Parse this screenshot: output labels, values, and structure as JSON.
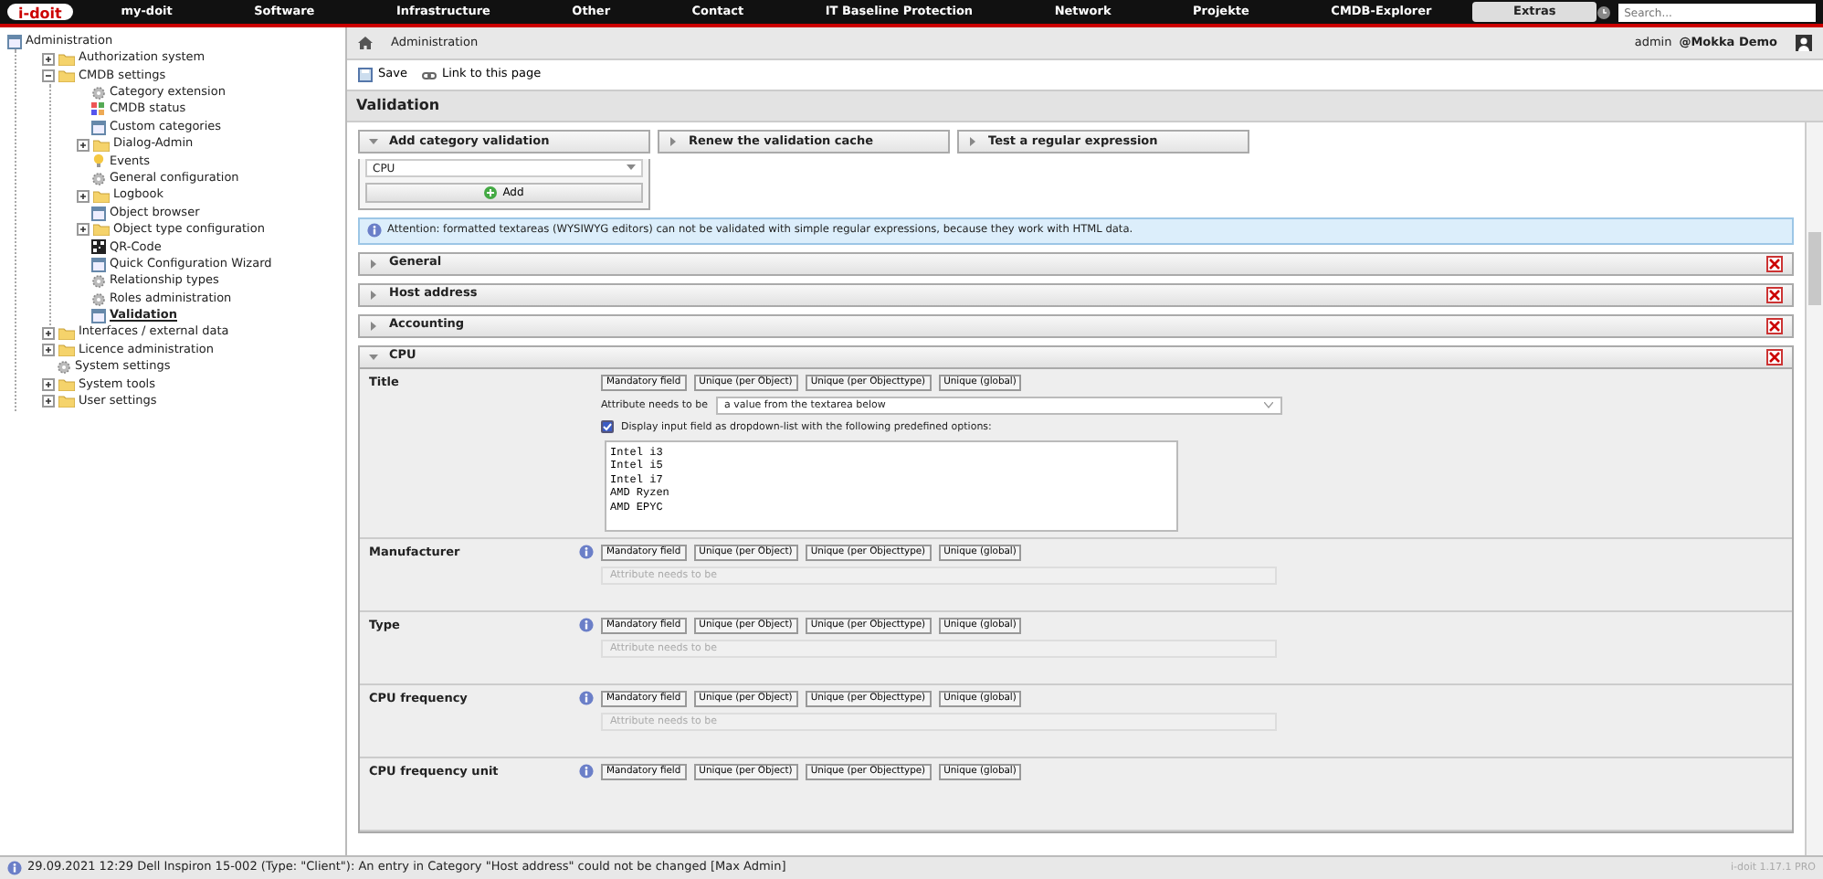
{
  "top_nav": {
    "logo": "i-doit",
    "items": [
      {
        "label": "my-doit",
        "selected": false
      },
      {
        "label": "Software",
        "selected": false
      },
      {
        "label": "Infrastructure",
        "selected": false
      },
      {
        "label": "Other",
        "selected": false
      },
      {
        "label": "Contact",
        "selected": false
      },
      {
        "label": "IT Baseline Protection",
        "selected": false
      },
      {
        "label": "Network",
        "selected": false
      },
      {
        "label": "Projekte",
        "selected": false
      },
      {
        "label": "CMDB-Explorer",
        "selected": false
      },
      {
        "label": "Extras",
        "selected": true
      }
    ],
    "search": {
      "placeholder": "Search..."
    }
  },
  "sidebar": {
    "root": "Administration",
    "items": [
      {
        "label": "Authorization system",
        "kind": "folder",
        "expanded": false
      },
      {
        "label": "CMDB settings",
        "kind": "folder",
        "expanded": true,
        "children": [
          {
            "label": "Category extension",
            "kind": "gear"
          },
          {
            "label": "CMDB status",
            "kind": "grid"
          },
          {
            "label": "Custom categories",
            "kind": "window"
          },
          {
            "label": "Dialog-Admin",
            "kind": "folder",
            "expanded": false
          },
          {
            "label": "Events",
            "kind": "bulb"
          },
          {
            "label": "General configuration",
            "kind": "gear"
          },
          {
            "label": "Logbook",
            "kind": "folder",
            "expanded": false
          },
          {
            "label": "Object browser",
            "kind": "window"
          },
          {
            "label": "Object type configuration",
            "kind": "folder",
            "expanded": false
          },
          {
            "label": "QR-Code",
            "kind": "qr"
          },
          {
            "label": "Quick Configuration Wizard",
            "kind": "window"
          },
          {
            "label": "Relationship types",
            "kind": "gear"
          },
          {
            "label": "Roles administration",
            "kind": "gear"
          },
          {
            "label": "Validation",
            "kind": "window",
            "selected": true
          }
        ]
      },
      {
        "label": "Interfaces / external data",
        "kind": "folder",
        "expanded": false
      },
      {
        "label": "Licence administration",
        "kind": "folder",
        "expanded": false
      },
      {
        "label": "System settings",
        "kind": "gear"
      },
      {
        "label": "System tools",
        "kind": "folder",
        "expanded": false
      },
      {
        "label": "User settings",
        "kind": "folder",
        "expanded": false
      }
    ]
  },
  "breadcrumb": {
    "items": [
      "Administration"
    ],
    "user": "admin",
    "tenant": "@Mokka Demo"
  },
  "toolbar": {
    "buttons": [
      "Save",
      "Link to this page"
    ]
  },
  "page_title": "Validation",
  "actions": [
    {
      "title": "Add category validation",
      "expanded": true,
      "select_value": "CPU",
      "button": "Add"
    },
    {
      "title": "Renew the validation cache",
      "expanded": false
    },
    {
      "title": "Test a regular expression",
      "expanded": false
    }
  ],
  "notice": "Attention: formatted textareas (WYSIWYG editors) can not be validated with simple regular expressions, because they work with HTML data.",
  "sections": [
    {
      "title": "General",
      "expanded": false
    },
    {
      "title": "Host address",
      "expanded": false
    },
    {
      "title": "Accounting",
      "expanded": false
    },
    {
      "title": "CPU",
      "expanded": true,
      "fields": [
        {
          "label": "Title",
          "kind": "detailed",
          "options": [
            "Mandatory field",
            "Unique (per Object)",
            "Unique (per Objecttype)",
            "Unique (global)"
          ],
          "rule_label": "Attribute needs to be",
          "rule_value": "a value from the textarea below",
          "dropdown_label": "Display input field as dropdown-list with the following predefined options:",
          "dropdown_checked": true,
          "textarea": "Intel i3\nIntel i5\nIntel i7\nAMD Ryzen\nAMD EPYC"
        },
        {
          "label": "Manufacturer",
          "kind": "basic",
          "options": [
            "Mandatory field",
            "Unique (per Object)",
            "Unique (per Objecttype)",
            "Unique (global)"
          ],
          "rule_label": "Attribute needs to be"
        },
        {
          "label": "Type",
          "kind": "basic",
          "options": [
            "Mandatory field",
            "Unique (per Object)",
            "Unique (per Objecttype)",
            "Unique (global)"
          ],
          "rule_label": "Attribute needs to be"
        },
        {
          "label": "CPU frequency",
          "kind": "basic",
          "options": [
            "Mandatory field",
            "Unique (per Object)",
            "Unique (per Objecttype)",
            "Unique (global)"
          ],
          "rule_label": "Attribute needs to be"
        },
        {
          "label": "CPU frequency unit",
          "kind": "basic",
          "options": [
            "Mandatory field",
            "Unique (per Object)",
            "Unique (per Objecttype)",
            "Unique (global)"
          ]
        }
      ]
    }
  ],
  "status_bar": {
    "message": "29.09.2021 12:29 Dell Inspiron 15-002 (Type: \"Client\"): An entry in Category \"Host address\" could not be changed [Max Admin]",
    "version": "i-doit 1.17.1 PRO"
  }
}
